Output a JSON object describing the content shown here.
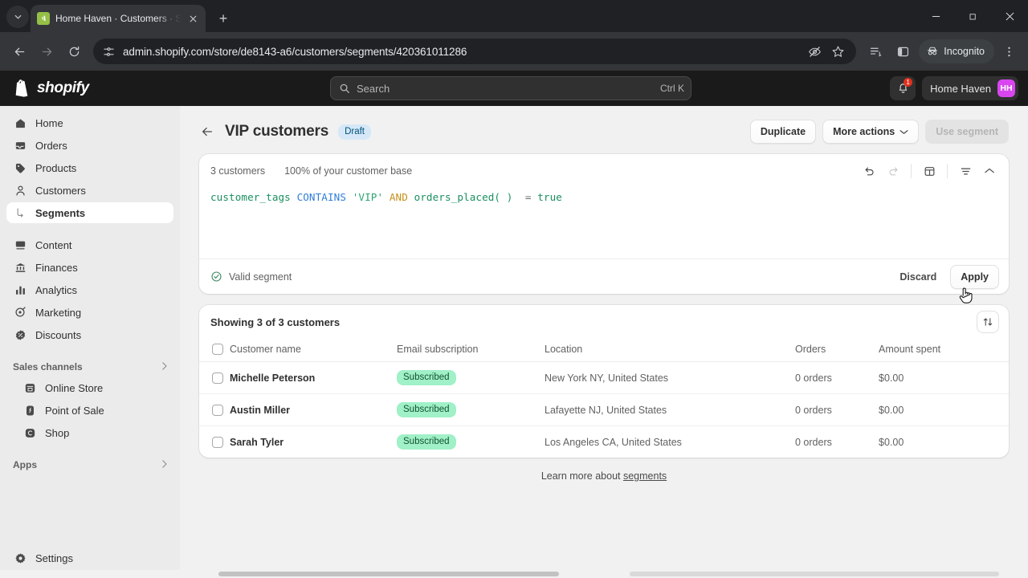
{
  "browser": {
    "tab": {
      "title": "Home Haven · Customers · Sho",
      "favicon": "shopify-icon",
      "close": "×"
    },
    "new_tab_label": "+",
    "window_controls": {
      "minimize": "minimize-icon",
      "maximize": "maximize-icon",
      "close": "close-icon"
    },
    "url": "admin.shopify.com/store/de8143-a6/customers/segments/420361011286",
    "nav": {
      "back": "back-icon",
      "forward": "forward-icon",
      "reload": "reload-icon"
    },
    "omnibox_icons": [
      "site-settings-icon",
      "tracking-blocked-icon",
      "bookmark-star-icon"
    ],
    "toolbar_icons": [
      "reading-list-icon",
      "side-panel-icon"
    ],
    "profile_label": "Incognito",
    "menu": "kebab-menu-icon"
  },
  "topbar": {
    "brand": "shopify",
    "search": {
      "placeholder": "Search",
      "shortcut": "Ctrl K",
      "icon": "search-icon"
    },
    "notifications": {
      "icon": "bell-icon",
      "count": "1"
    },
    "store_name": "Home Haven",
    "avatar_initials": "HH"
  },
  "sidebar": {
    "items": [
      {
        "label": "Home",
        "icon": "home-icon"
      },
      {
        "label": "Orders",
        "icon": "orders-icon"
      },
      {
        "label": "Products",
        "icon": "tag-icon"
      },
      {
        "label": "Customers",
        "icon": "person-icon"
      }
    ],
    "sub_item": {
      "label": "Segments",
      "icon": "branch-icon",
      "active": true
    },
    "items2": [
      {
        "label": "Content",
        "icon": "content-icon"
      },
      {
        "label": "Finances",
        "icon": "bank-icon"
      },
      {
        "label": "Analytics",
        "icon": "chart-icon"
      },
      {
        "label": "Marketing",
        "icon": "marketing-icon"
      },
      {
        "label": "Discounts",
        "icon": "discount-icon"
      }
    ],
    "sales_channels": {
      "label": "Sales channels",
      "chevron": "chevron-right-icon"
    },
    "channels": [
      {
        "label": "Online Store",
        "icon": "store-icon"
      },
      {
        "label": "Point of Sale",
        "icon": "pos-icon"
      },
      {
        "label": "Shop",
        "icon": "shop-icon"
      }
    ],
    "apps": {
      "label": "Apps",
      "chevron": "chevron-right-icon"
    },
    "settings": {
      "label": "Settings",
      "icon": "gear-icon"
    }
  },
  "page": {
    "back_arrow": "←",
    "title": "VIP customers",
    "status_badge": "Draft",
    "actions": {
      "duplicate": "Duplicate",
      "more_actions": "More actions",
      "more_actions_chevron": "chevron-down-icon",
      "use_segment": "Use segment"
    }
  },
  "query_card": {
    "customer_count": "3 customers",
    "percent_text": "100% of your customer base",
    "tools": [
      {
        "name": "undo-icon",
        "disabled": false
      },
      {
        "name": "redo-icon",
        "disabled": true
      },
      {
        "name": "templates-icon",
        "disabled": false
      },
      {
        "name": "filter-icon",
        "disabled": false
      },
      {
        "name": "collapse-chevron-icon",
        "disabled": false
      }
    ],
    "code_tokens": [
      {
        "text": "customer_tags",
        "type": "field"
      },
      {
        "text": " ",
        "type": "plain"
      },
      {
        "text": "CONTAINS",
        "type": "op"
      },
      {
        "text": " ",
        "type": "plain"
      },
      {
        "text": "'VIP'",
        "type": "str"
      },
      {
        "text": " ",
        "type": "plain"
      },
      {
        "text": "AND",
        "type": "and"
      },
      {
        "text": " ",
        "type": "plain"
      },
      {
        "text": "orders_placed( )",
        "type": "fn"
      },
      {
        "text": "  ",
        "type": "plain"
      },
      {
        "text": "=",
        "type": "eq"
      },
      {
        "text": " ",
        "type": "plain"
      },
      {
        "text": "true",
        "type": "bool"
      }
    ],
    "validity": {
      "icon": "check-circle-icon",
      "label": "Valid segment"
    },
    "discard_label": "Discard",
    "apply_label": "Apply"
  },
  "table": {
    "showing_text": "Showing 3 of 3 customers",
    "sort_icon": "sort-icon",
    "columns": [
      "Customer name",
      "Email subscription",
      "Location",
      "Orders",
      "Amount spent"
    ],
    "rows": [
      {
        "name": "Michelle Peterson",
        "email_subscription": "Subscribed",
        "location": "New York NY, United States",
        "orders": "0 orders",
        "amount": "$0.00"
      },
      {
        "name": "Austin Miller",
        "email_subscription": "Subscribed",
        "location": "Lafayette NJ, United States",
        "orders": "0 orders",
        "amount": "$0.00"
      },
      {
        "name": "Sarah Tyler",
        "email_subscription": "Subscribed",
        "location": "Los Angeles CA, United States",
        "orders": "0 orders",
        "amount": "$0.00"
      }
    ]
  },
  "footer": {
    "learn_prefix": "Learn more about ",
    "learn_link": "segments"
  },
  "colors": {
    "accent_green": "#a0f0c8",
    "badge_blue": "#d6e8f7",
    "avatar": "#d946ef",
    "notification_red": "#e0301e"
  }
}
